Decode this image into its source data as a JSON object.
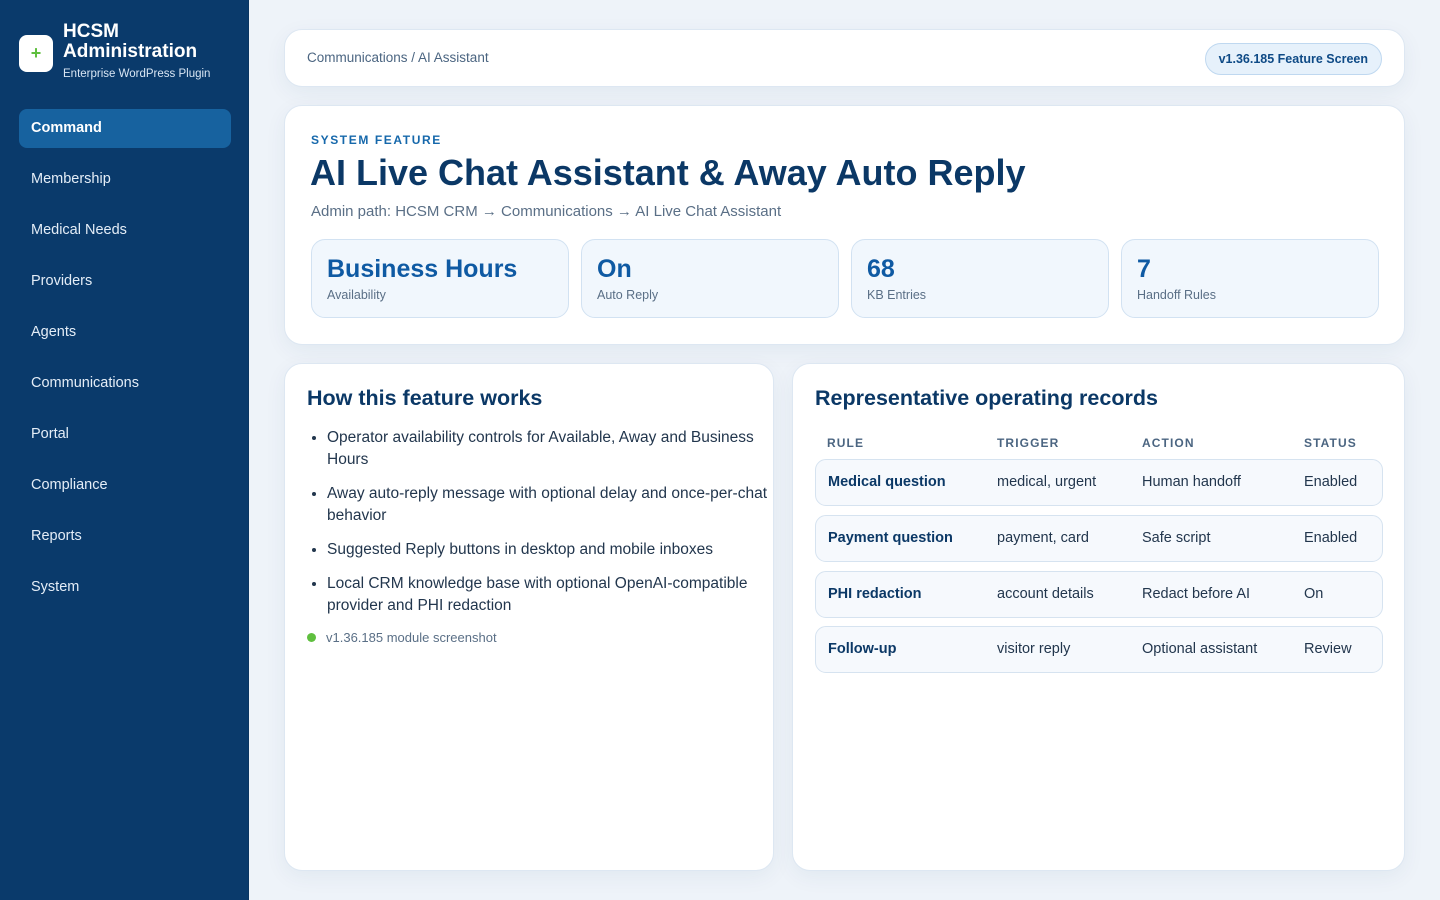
{
  "brand": {
    "logo_glyph": "+",
    "title": "HCSM Administration",
    "subtitle": "Enterprise WordPress Plugin"
  },
  "nav": {
    "items": [
      {
        "label": "Command",
        "active": true
      },
      {
        "label": "Membership",
        "active": false
      },
      {
        "label": "Medical Needs",
        "active": false
      },
      {
        "label": "Providers",
        "active": false
      },
      {
        "label": "Agents",
        "active": false
      },
      {
        "label": "Communications",
        "active": false
      },
      {
        "label": "Portal",
        "active": false
      },
      {
        "label": "Compliance",
        "active": false
      },
      {
        "label": "Reports",
        "active": false
      },
      {
        "label": "System",
        "active": false
      }
    ]
  },
  "topbar": {
    "breadcrumb": "Communications / AI Assistant",
    "version_badge": "v1.36.185 Feature Screen"
  },
  "hero": {
    "eyebrow": "SYSTEM FEATURE",
    "title": "AI Live Chat Assistant & Away Auto Reply",
    "admin_path": "Admin path: HCSM CRM → Communications → AI Live Chat Assistant",
    "stats": [
      {
        "value": "Business Hours",
        "label": "Availability"
      },
      {
        "value": "On",
        "label": "Auto Reply"
      },
      {
        "value": "68",
        "label": "KB Entries"
      },
      {
        "value": "7",
        "label": "Handoff Rules"
      }
    ]
  },
  "how": {
    "title": "How this feature works",
    "items": [
      "Operator availability controls for Available, Away and Business Hours",
      "Away auto-reply message with optional delay and once-per-chat behavior",
      "Suggested Reply buttons in desktop and mobile inboxes",
      "Local CRM knowledge base with optional OpenAI-compatible provider and PHI redaction"
    ],
    "module_note": "v1.36.185 module screenshot"
  },
  "records": {
    "title": "Representative operating records",
    "columns": [
      "RULE",
      "TRIGGER",
      "ACTION",
      "STATUS"
    ],
    "rows": [
      {
        "rule": "Medical question",
        "trigger": "medical, urgent",
        "action": "Human handoff",
        "status": "Enabled"
      },
      {
        "rule": "Payment question",
        "trigger": "payment, card",
        "action": "Safe script",
        "status": "Enabled"
      },
      {
        "rule": "PHI redaction",
        "trigger": "account details",
        "action": "Redact before AI",
        "status": "On"
      },
      {
        "rule": "Follow-up",
        "trigger": "visitor reply",
        "action": "Optional assistant",
        "status": "Review"
      }
    ]
  },
  "colors": {
    "sidebar": "#0a3a6b",
    "active_nav": "#17629f",
    "accent": "#0f5aa3",
    "status_dot": "#5fbf3f"
  }
}
